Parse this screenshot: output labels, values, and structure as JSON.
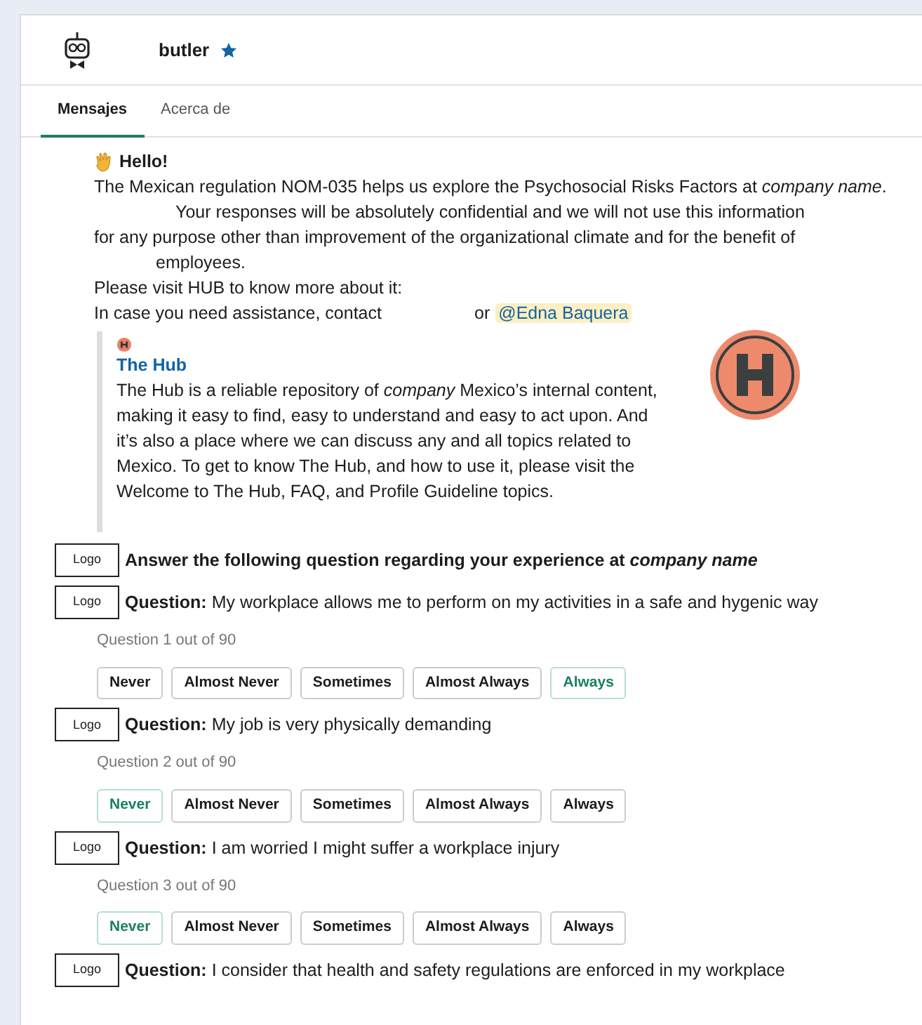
{
  "header": {
    "name": "butler",
    "starred": true
  },
  "tabs": [
    {
      "label": "Mensajes",
      "selected": true
    },
    {
      "label": "Acerca de",
      "selected": false
    }
  ],
  "message": {
    "greeting": "Hello!",
    "lines": [
      {
        "kind": "plain",
        "text": "The Mexican regulation NOM-035 helps us explore the Psychosocial Risks Factors at *company name*."
      },
      {
        "kind": "indent_wide",
        "text": "Your responses will be absolutely confidential and we will not use this information"
      },
      {
        "kind": "plain",
        "text": "for any purpose other than improvement of the organizational climate and for the benefit of"
      },
      {
        "kind": "indent",
        "text": "employees."
      },
      {
        "kind": "plain",
        "text": "Please visit HUB to know more about it:"
      }
    ],
    "contact": {
      "text": "In case you need assistance, contact",
      "or": "or",
      "mention": "@Edna Baquera"
    },
    "attachment": {
      "title": "The Hub",
      "body": "The Hub is a reliable repository of *company* Mexico’s internal content, making it easy to find, easy to understand and easy to act upon. And it’s also a place where we can discuss any and all topics related to Mexico. To get to know The Hub, and how to use it, please visit the Welcome to The Hub, FAQ, and Profile Guideline topics."
    }
  },
  "intro": {
    "logo": "Logo",
    "text": "Answer the following question regarding your experience at *company name*"
  },
  "questions": [
    {
      "logo": "Logo",
      "label": "Question:",
      "text": "My workplace allows me to perform on my activities in a safe and hygenic way",
      "counter": "Question 1 out of 90",
      "options": [
        {
          "label": "Never",
          "selected": false
        },
        {
          "label": "Almost Never",
          "selected": false
        },
        {
          "label": "Sometimes",
          "selected": false
        },
        {
          "label": "Almost Always",
          "selected": false
        },
        {
          "label": "Always",
          "selected": true
        }
      ]
    },
    {
      "logo": "Logo",
      "label": "Question:",
      "text": "My job is very physically demanding",
      "counter": "Question 2 out of 90",
      "options": [
        {
          "label": "Never",
          "selected": true
        },
        {
          "label": "Almost Never",
          "selected": false
        },
        {
          "label": "Sometimes",
          "selected": false
        },
        {
          "label": "Almost Always",
          "selected": false
        },
        {
          "label": "Always",
          "selected": false
        }
      ]
    },
    {
      "logo": "Logo",
      "label": "Question:",
      "text": "I am worried I might suffer a workplace injury",
      "counter": "Question 3 out of 90",
      "options": [
        {
          "label": "Never",
          "selected": true
        },
        {
          "label": "Almost Never",
          "selected": false
        },
        {
          "label": "Sometimes",
          "selected": false
        },
        {
          "label": "Almost Always",
          "selected": false
        },
        {
          "label": "Always",
          "selected": false
        }
      ]
    },
    {
      "logo": "Logo",
      "label": "Question:",
      "text": "I consider that health and safety regulations are enforced in my workplace"
    }
  ]
}
